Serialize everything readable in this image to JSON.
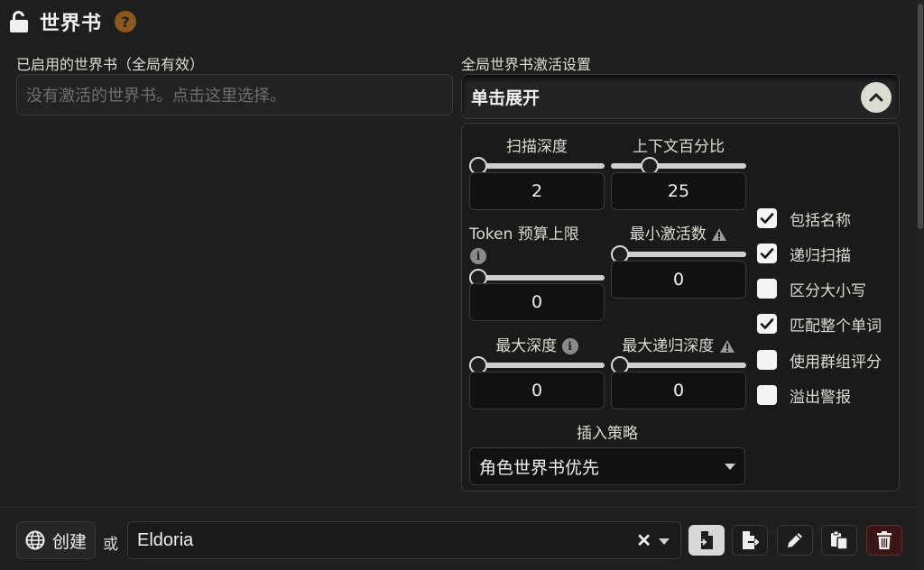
{
  "header": {
    "title": "世界书",
    "help_glyph": "?"
  },
  "active_books": {
    "label": "已启用的世界书（全局有效）",
    "placeholder": "没有激活的世界书。点击这里选择。"
  },
  "global_settings": {
    "label": "全局世界书激活设置",
    "drawer_title": "单击展开",
    "scan_depth": {
      "label": "扫描深度",
      "value": "2",
      "slider_fraction": 0.0
    },
    "context_percent": {
      "label": "上下文百分比",
      "value": "25",
      "slider_fraction": 0.25
    },
    "token_budget": {
      "label": "Token 预算上限",
      "value": "0",
      "slider_fraction": 0.0
    },
    "min_activations": {
      "label": "最小激活数",
      "value": "0",
      "slider_fraction": 0.0
    },
    "max_depth": {
      "label": "最大深度",
      "value": "0",
      "slider_fraction": 0.0
    },
    "max_recursion_depth": {
      "label": "最大递归深度",
      "value": "0",
      "slider_fraction": 0.0
    },
    "checkboxes": [
      {
        "label": "包括名称",
        "checked": true
      },
      {
        "label": "递归扫描",
        "checked": true
      },
      {
        "label": "区分大小写",
        "checked": false
      },
      {
        "label": "匹配整个单词",
        "checked": true
      },
      {
        "label": "使用群组评分",
        "checked": false
      },
      {
        "label": "溢出警报",
        "checked": false
      }
    ],
    "insertion_strategy": {
      "label": "插入策略",
      "value": "角色世界书优先"
    }
  },
  "bottom_bar": {
    "create_label": "创建",
    "or_label": "或",
    "selected_book": "Eldoria",
    "clear_glyph": "✕"
  },
  "colors": {
    "accent_help": "#8a5a1c",
    "delete_bg": "#3a1616"
  }
}
